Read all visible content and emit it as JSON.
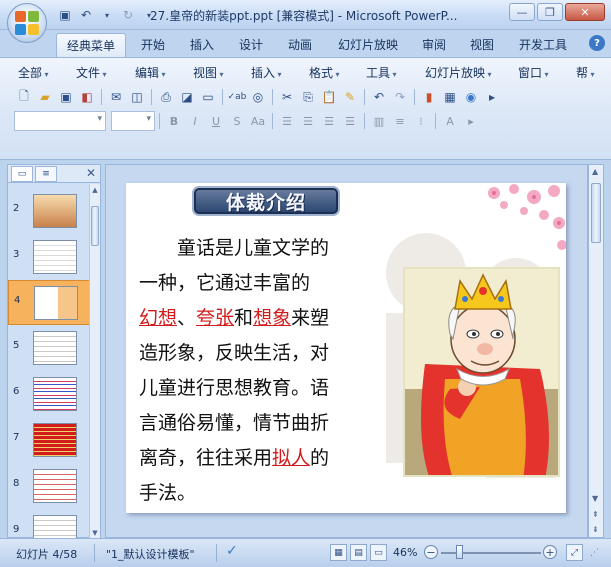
{
  "window": {
    "title": "27.皇帝的新装ppt.ppt [兼容模式] - Microsoft PowerP...",
    "minimize": "—",
    "restore": "❐",
    "close": "✕"
  },
  "ribbon_tabs": [
    {
      "label": "经典菜单",
      "active": true
    },
    {
      "label": "开始"
    },
    {
      "label": "插入"
    },
    {
      "label": "设计"
    },
    {
      "label": "动画"
    },
    {
      "label": "幻灯片放映"
    },
    {
      "label": "审阅"
    },
    {
      "label": "视图"
    },
    {
      "label": "开发工具"
    }
  ],
  "help": "?",
  "menus": [
    "全部",
    "文件",
    "编辑",
    "视图",
    "插入",
    "格式",
    "工具",
    "幻灯片放映",
    "窗口",
    "帮"
  ],
  "toolbar_icons": [
    "new-file-icon",
    "open-folder-icon",
    "save-icon",
    "permission-icon",
    "email-icon",
    "print-preview-icon",
    "print-icon",
    "spelling-icon",
    "research-icon",
    "cut-icon",
    "copy-icon",
    "paste-icon",
    "format-painter-icon",
    "undo-icon",
    "redo-icon",
    "chart-icon",
    "table-icon",
    "expand-icon"
  ],
  "format_buttons": [
    "B",
    "I",
    "U",
    "S",
    "Aa"
  ],
  "slide_thumbnails": [
    {
      "number": "2"
    },
    {
      "number": "3"
    },
    {
      "number": "4",
      "selected": true
    },
    {
      "number": "5"
    },
    {
      "number": "6"
    },
    {
      "number": "7"
    },
    {
      "number": "8"
    },
    {
      "number": "9"
    }
  ],
  "slide": {
    "badge": "体裁介绍",
    "line1": "童话是儿童文学的",
    "line2": "一种，它通过丰富的",
    "fill1": "幻想",
    "sep1": "、",
    "fill2": "夸张",
    "and": "和",
    "fill3": "想象",
    "line3_tail": "来塑",
    "line4": "造形象，反映生活，对",
    "line5": "儿童进行思想教育。语",
    "line6": "言通俗易懂，情节曲折",
    "line7_head": "离奇，往往采用",
    "fill4": "拟人",
    "line7_tail": "的",
    "line8": "手法。"
  },
  "status": {
    "slide_info": "幻灯片 4/58",
    "template": "\"1_默认设计模板\"",
    "zoom": "46%",
    "zoom_minus": "−",
    "zoom_plus": "+"
  },
  "colors": {
    "accent_red": "#d21c1c",
    "selected_thumb": "#f7b25e",
    "ribbon_blue": "#bfd4ef"
  }
}
